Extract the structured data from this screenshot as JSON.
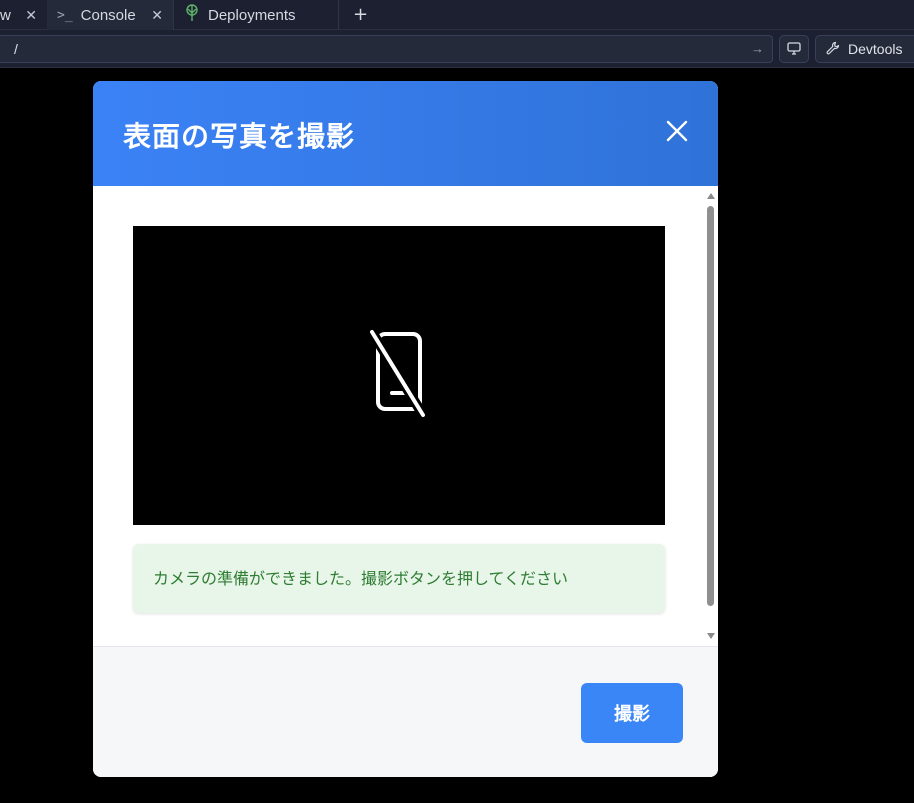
{
  "tabs": {
    "cut_tab": {
      "label": "w",
      "close": "✕"
    },
    "console": {
      "label": "Console",
      "close": "✕"
    },
    "deployments": {
      "label": "Deployments"
    },
    "new_tab": "+"
  },
  "urlbar": {
    "path": "/",
    "devtools_label": "Devtools"
  },
  "modal": {
    "title": "表面の写真を撮影",
    "status_message": "カメラの準備ができました。撮影ボタンを押してください",
    "capture_label": "撮影"
  },
  "colors": {
    "header_start": "#3b82f6",
    "header_end": "#2f72d8",
    "status_bg": "#e8f5e9",
    "status_text": "#2e7d32",
    "primary_button": "#3b86f7"
  },
  "icons": {
    "close": "close-icon",
    "camera_placeholder": "device-off-icon"
  }
}
